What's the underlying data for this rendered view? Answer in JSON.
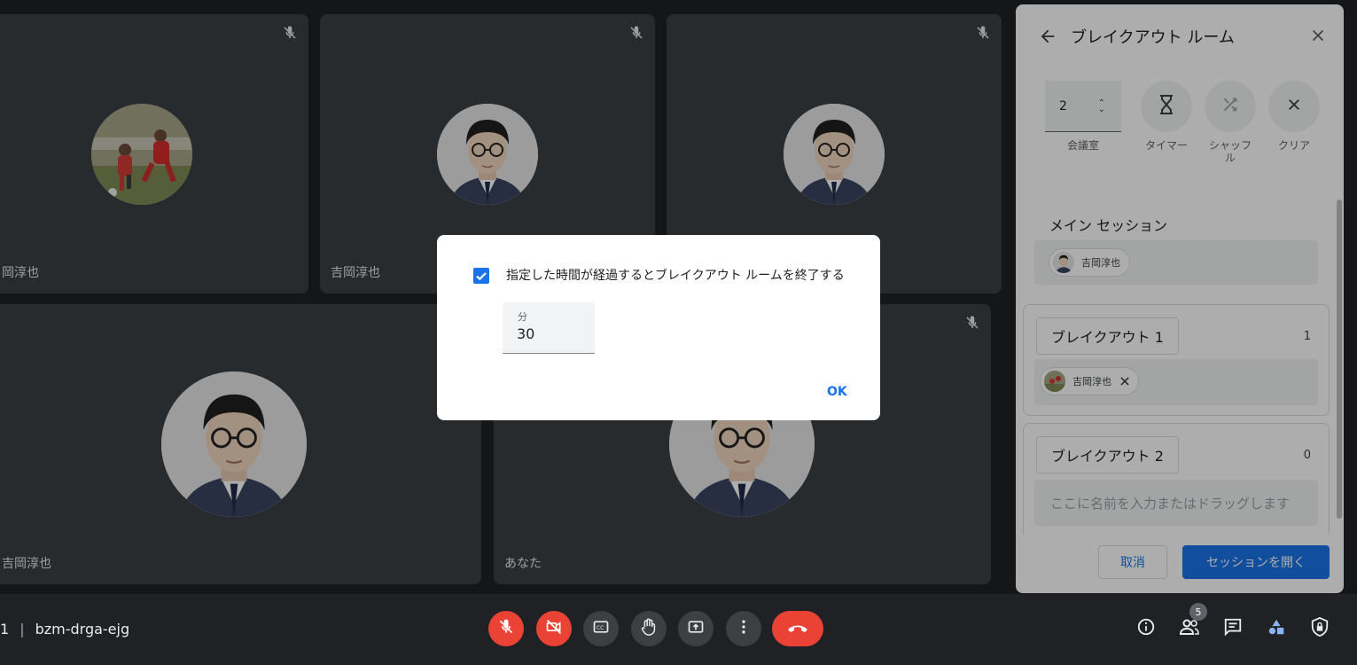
{
  "tiles": [
    {
      "name": "岡淳也",
      "avatar": "soccer-photo"
    },
    {
      "name": "吉岡淳也",
      "avatar": "illustrated-face"
    },
    {
      "name": "",
      "avatar": "illustrated-face"
    },
    {
      "name": "吉岡淳也",
      "avatar": "illustrated-face"
    },
    {
      "name": "あなた",
      "avatar": "illustrated-face"
    }
  ],
  "panel": {
    "title": "ブレイクアウト ルーム",
    "room_count_value": "2",
    "tools": {
      "rooms_label": "会議室",
      "timer_label": "タイマー",
      "shuffle_label": "シャッフル",
      "clear_label": "クリア"
    },
    "main_session_title": "メイン セッション",
    "main_session_participant": "吉岡淳也",
    "rooms": [
      {
        "name": "ブレイクアウト 1",
        "count": "1",
        "participant": "吉岡淳也"
      },
      {
        "name": "ブレイクアウト 2",
        "count": "0",
        "placeholder": "ここに名前を入力またはドラッグします"
      }
    ],
    "cancel_label": "取消",
    "open_label": "セッションを開く"
  },
  "dialog": {
    "checkbox_label": "指定した時間が経過するとブレイクアウト ルームを終了する",
    "checked": true,
    "minutes_label": "分",
    "minutes_value": "30",
    "ok_label": "OK"
  },
  "bottom": {
    "time_fragment": "1",
    "meeting_code": "bzm-drga-ejg",
    "participants_badge": "5"
  },
  "colors": {
    "accent": "#1a73e8",
    "danger": "#ea4335",
    "tile_bg": "#3c4043",
    "page_bg": "#202124"
  }
}
